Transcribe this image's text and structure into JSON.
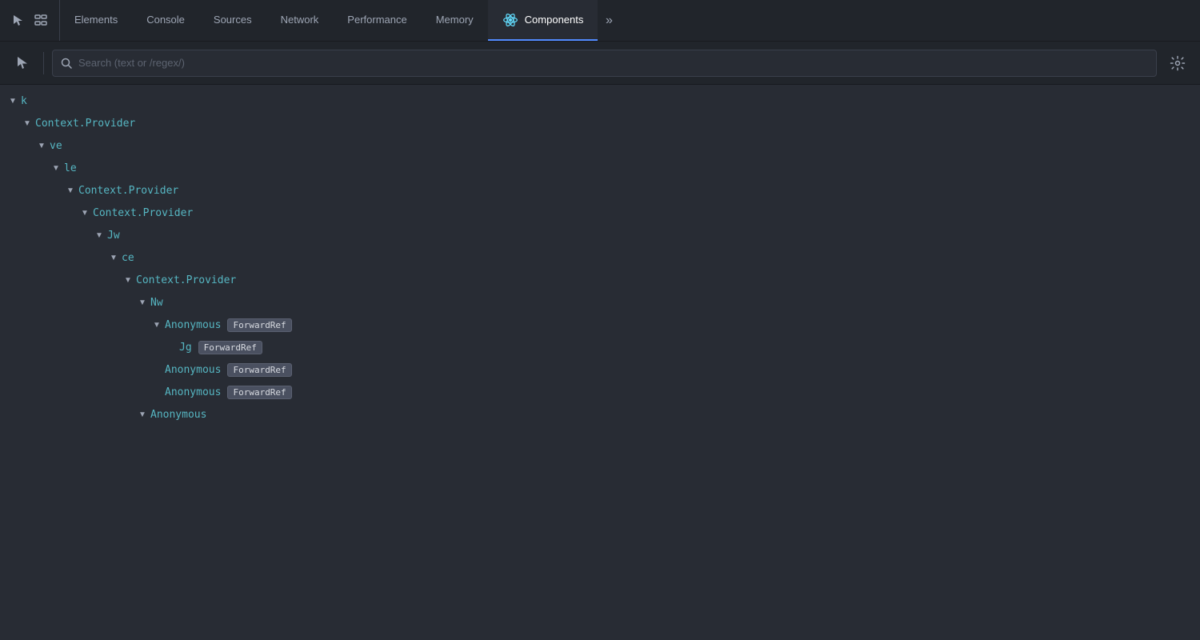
{
  "tabbar": {
    "tabs": [
      {
        "label": "Elements",
        "active": false
      },
      {
        "label": "Console",
        "active": false
      },
      {
        "label": "Sources",
        "active": false
      },
      {
        "label": "Network",
        "active": false
      },
      {
        "label": "Performance",
        "active": false
      },
      {
        "label": "Memory",
        "active": false
      },
      {
        "label": "Components",
        "active": true
      }
    ],
    "more_label": "»"
  },
  "toolbar": {
    "search_placeholder": "Search (text or /regex/)"
  },
  "tree": {
    "nodes": [
      {
        "id": 1,
        "indent": 0,
        "arrow": "expanded",
        "label": "k",
        "badge": null
      },
      {
        "id": 2,
        "indent": 1,
        "arrow": "expanded",
        "label": "Context.Provider",
        "badge": null
      },
      {
        "id": 3,
        "indent": 2,
        "arrow": "expanded",
        "label": "ve",
        "badge": null
      },
      {
        "id": 4,
        "indent": 3,
        "arrow": "expanded",
        "label": "le",
        "badge": null
      },
      {
        "id": 5,
        "indent": 4,
        "arrow": "expanded",
        "label": "Context.Provider",
        "badge": null
      },
      {
        "id": 6,
        "indent": 5,
        "arrow": "expanded",
        "label": "Context.Provider",
        "badge": null
      },
      {
        "id": 7,
        "indent": 6,
        "arrow": "expanded",
        "label": "Jw",
        "badge": null
      },
      {
        "id": 8,
        "indent": 7,
        "arrow": "expanded",
        "label": "ce",
        "badge": null
      },
      {
        "id": 9,
        "indent": 8,
        "arrow": "expanded",
        "label": "Context.Provider",
        "badge": null
      },
      {
        "id": 10,
        "indent": 9,
        "arrow": "expanded",
        "label": "Nw",
        "badge": null
      },
      {
        "id": 11,
        "indent": 10,
        "arrow": "expanded",
        "label": "Anonymous",
        "badge": "ForwardRef"
      },
      {
        "id": 12,
        "indent": 11,
        "arrow": "leaf",
        "label": "Jg",
        "badge": "ForwardRef"
      },
      {
        "id": 13,
        "indent": 10,
        "arrow": "leaf",
        "label": "Anonymous",
        "badge": "ForwardRef"
      },
      {
        "id": 14,
        "indent": 10,
        "arrow": "leaf",
        "label": "Anonymous",
        "badge": "ForwardRef"
      },
      {
        "id": 15,
        "indent": 9,
        "arrow": "expanded",
        "label": "Anonymous",
        "badge": null
      }
    ]
  }
}
